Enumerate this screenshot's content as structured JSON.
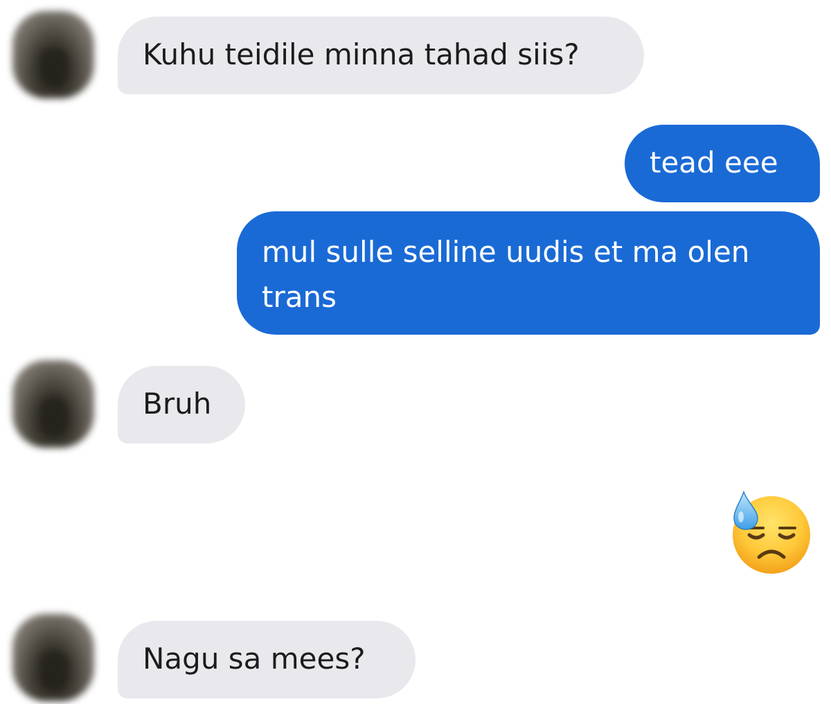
{
  "conversation": {
    "messages": [
      {
        "sender": "them",
        "text": "Kuhu teidile minna tahad siis?"
      },
      {
        "sender": "me",
        "text": "tead eee"
      },
      {
        "sender": "me",
        "text": "mul sulle selline uudis et ma olen trans"
      },
      {
        "sender": "them",
        "text": "Bruh"
      },
      {
        "sender": "me",
        "emoji": "downcast-face-with-sweat-icon"
      },
      {
        "sender": "them",
        "text": "Nagu sa mees?"
      }
    ]
  },
  "colors": {
    "incoming_bubble": "#e9e9ed",
    "outgoing_bubble": "#1a6ad6",
    "incoming_text": "#1c1c1e",
    "outgoing_text": "#ffffff"
  }
}
